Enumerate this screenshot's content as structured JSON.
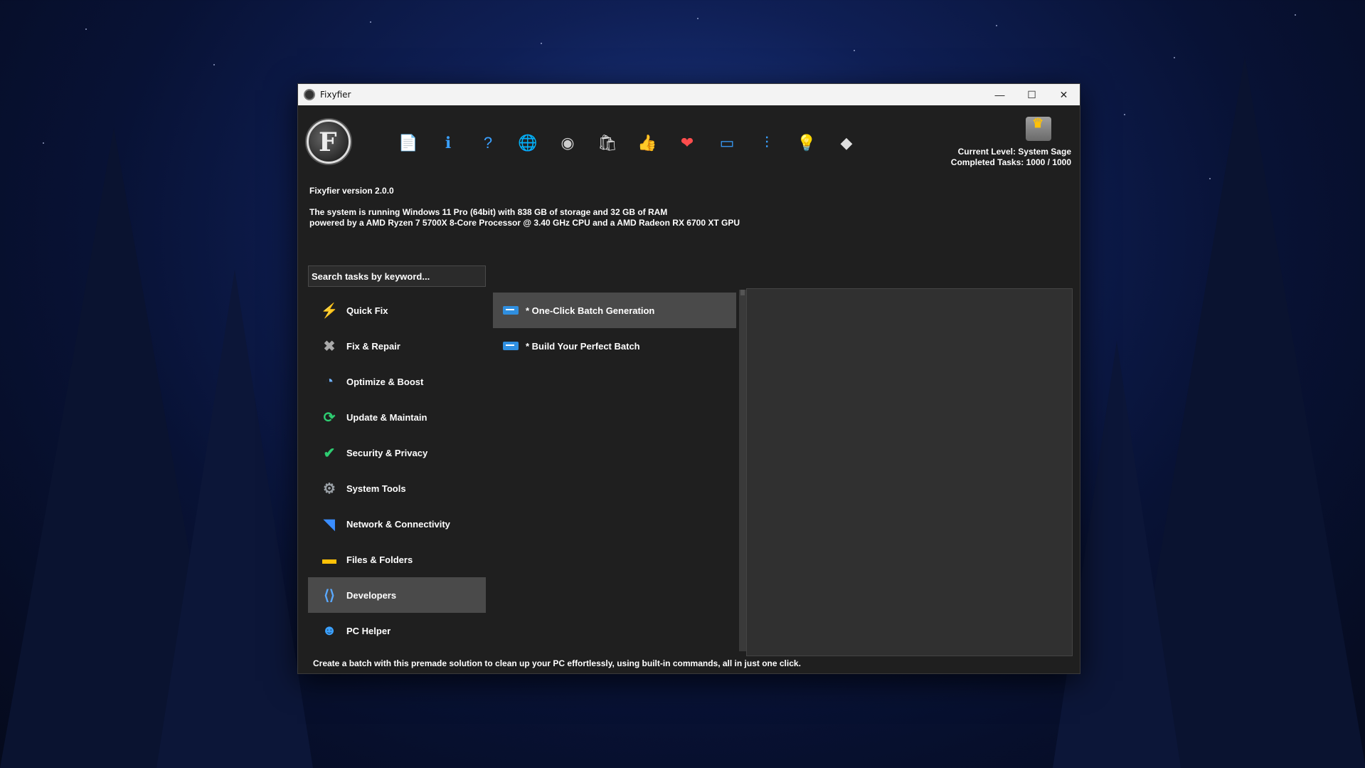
{
  "window": {
    "title": "Fixyfier"
  },
  "window_controls": {
    "minimize": "—",
    "maximize": "☐",
    "close": "✕"
  },
  "toolbar": [
    {
      "name": "document-icon",
      "glyph": "📄",
      "color": "#3aa0ff"
    },
    {
      "name": "info-icon",
      "glyph": "ℹ",
      "color": "#3aa0ff"
    },
    {
      "name": "help-icon",
      "glyph": "?",
      "color": "#3aa0ff"
    },
    {
      "name": "www-icon",
      "glyph": "🌐",
      "color": "#3aa0ff"
    },
    {
      "name": "github-icon",
      "glyph": "◉",
      "color": "#cccccc"
    },
    {
      "name": "store-icon",
      "glyph": "🛍",
      "color": "#e0e0e0"
    },
    {
      "name": "thumbs-up-icon",
      "glyph": "👍",
      "color": "#ffb300"
    },
    {
      "name": "donate-heart-icon",
      "glyph": "❤",
      "color": "#ff4d4d"
    },
    {
      "name": "window-toggle-icon",
      "glyph": "▭",
      "color": "#3aa0ff"
    },
    {
      "name": "sliders-icon",
      "glyph": "⫶",
      "color": "#3aa0ff"
    },
    {
      "name": "lightbulb-icon",
      "glyph": "💡",
      "color": "#e0e0e0"
    },
    {
      "name": "eraser-icon",
      "glyph": "◆",
      "color": "#e0e0e0"
    }
  ],
  "level": {
    "current": "Current Level: System Sage",
    "completed": "Completed Tasks: 1000 / 1000"
  },
  "version": "Fixyfier version 2.0.0",
  "sysinfo": {
    "line1": "The system is running Windows 11 Pro (64bit) with 838 GB of storage and 32 GB of RAM",
    "line2": "powered by a AMD Ryzen 7 5700X 8-Core Processor @ 3.40 GHz CPU and a AMD Radeon RX 6700 XT GPU"
  },
  "search": {
    "placeholder": "Search tasks by keyword..."
  },
  "categories": [
    {
      "label": "Quick Fix",
      "icon": "⚡",
      "color": "#ffb300"
    },
    {
      "label": "Fix & Repair",
      "icon": "✖",
      "color": "#aaaaaa"
    },
    {
      "label": "Optimize & Boost",
      "icon": "◔",
      "color": "#6fb1ff"
    },
    {
      "label": "Update & Maintain",
      "icon": "⟳",
      "color": "#2ecc71"
    },
    {
      "label": "Security & Privacy",
      "icon": "✔",
      "color": "#2ecc71"
    },
    {
      "label": "System Tools",
      "icon": "⚙",
      "color": "#9aa0a6"
    },
    {
      "label": "Network & Connectivity",
      "icon": "◥",
      "color": "#3a8dff"
    },
    {
      "label": "Files & Folders",
      "icon": "▬",
      "color": "#ffc107"
    },
    {
      "label": "Developers",
      "icon": "⟨⟩",
      "color": "#5aa9ff"
    },
    {
      "label": "PC Helper",
      "icon": "☻",
      "color": "#3aa0ff"
    }
  ],
  "tasks": [
    {
      "label": "* One-Click Batch Generation"
    },
    {
      "label": "* Build Your Perfect Batch"
    }
  ],
  "footer": "Create a batch with this premade solution to clean up your PC effortlessly, using built-in commands, all in just one click."
}
